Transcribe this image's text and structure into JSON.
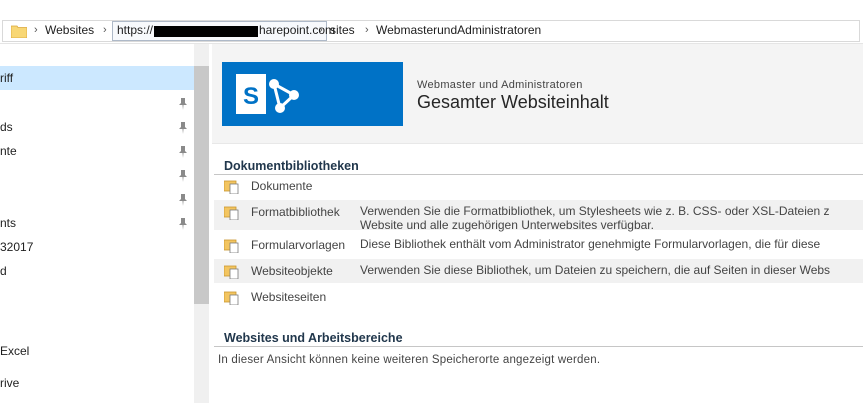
{
  "addressbar": {
    "crumbs": [
      "Websites",
      "https://",
      "harepoint.com",
      "sites",
      "WebmasterundAdministratoren"
    ]
  },
  "sidebar": {
    "items": [
      {
        "label": "riff",
        "pinned": false,
        "selected": true
      },
      {
        "label": "",
        "pinned": true
      },
      {
        "label": "ds",
        "pinned": true
      },
      {
        "label": "nte",
        "pinned": true
      },
      {
        "label": "",
        "pinned": true
      },
      {
        "label": "",
        "pinned": true
      },
      {
        "label": "nts",
        "pinned": true
      },
      {
        "label": "32017",
        "pinned": false
      },
      {
        "label": "d",
        "pinned": false
      },
      {
        "label": "Excel",
        "pinned": false
      },
      {
        "label": "rive",
        "pinned": false
      }
    ]
  },
  "site": {
    "subtitle": "Webmaster und Administratoren",
    "title": "Gesamter Websiteinhalt",
    "logo_letter": "S",
    "logo_color": "#0072c6"
  },
  "libraries": {
    "heading": "Dokumentbibliotheken",
    "items": [
      {
        "name": "Dokumente",
        "description": ""
      },
      {
        "name": "Formatbibliothek",
        "description": "Verwenden Sie die Formatbibliothek, um Stylesheets wie z. B. CSS- oder XSL-Dateien z",
        "description2": "Website und alle zugehörigen Unterwebsites verfügbar."
      },
      {
        "name": "Formularvorlagen",
        "description": "Diese Bibliothek enthält vom Administrator genehmigte Formularvorlagen, die für diese"
      },
      {
        "name": "Websiteobjekte",
        "description": "Verwenden Sie diese Bibliothek, um Dateien zu speichern, die auf Seiten in dieser Webs"
      },
      {
        "name": "Websiteseiten",
        "description": ""
      }
    ]
  },
  "websites": {
    "heading": "Websites und Arbeitsbereiche",
    "empty_message": "In dieser Ansicht können keine weiteren Speicherorte angezeigt werden."
  },
  "colors": {
    "accent": "#0072c6",
    "heading": "#21374c",
    "selection": "#cce8ff"
  }
}
